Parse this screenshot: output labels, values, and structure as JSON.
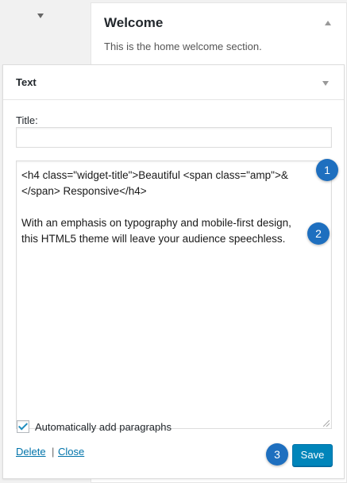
{
  "welcome_widget": {
    "title": "Welcome",
    "description": "This is the home welcome section."
  },
  "text_widget": {
    "title": "Text",
    "title_field_label": "Title:",
    "title_field_value": "",
    "content_lines": [
      "<h4 class=\"widget-title\">Beautiful <span class=\"amp\">&",
      "</span> Responsive</h4>",
      "With an emphasis on typography and mobile-first design,",
      "this HTML5 theme will leave your audience speechless."
    ],
    "auto_paragraphs_label": "Automatically add paragraphs",
    "auto_paragraphs_checked": true,
    "delete_label": "Delete",
    "separator": "|",
    "close_label": "Close",
    "save_label": "Save"
  },
  "callouts": [
    "1",
    "2",
    "3"
  ],
  "colors": {
    "accent": "#0085ba",
    "link": "#0073aa",
    "callout": "#1e6fbf"
  }
}
